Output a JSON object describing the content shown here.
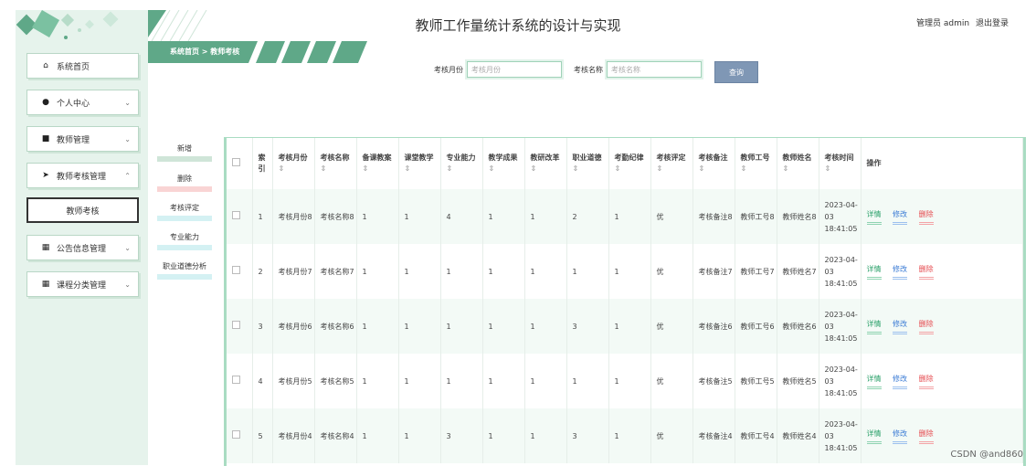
{
  "header": {
    "title": "教师工作量统计系统的设计与实现",
    "user": "管理员 admin",
    "logout": "退出登录"
  },
  "breadcrumb": {
    "home": "系统首页",
    "sep": ">",
    "current": "教师考核"
  },
  "sidebar": {
    "items": [
      {
        "icon": "home-icon",
        "label": "系统首页"
      },
      {
        "icon": "user-icon",
        "label": "个人中心"
      },
      {
        "icon": "briefcase-icon",
        "label": "教师管理"
      },
      {
        "icon": "send-icon",
        "label": "教师考核管理"
      },
      {
        "icon": "grid-icon",
        "label": "公告信息管理"
      },
      {
        "icon": "grid-icon",
        "label": "课程分类管理"
      }
    ],
    "sub_item": "教师考核"
  },
  "search": {
    "month_label": "考核月份",
    "month_placeholder": "考核月份",
    "name_label": "考核名称",
    "name_placeholder": "考核名称",
    "button": "查询"
  },
  "actions": {
    "add": "新增",
    "delete": "删除",
    "eval": "考核评定",
    "ability": "专业能力",
    "ethics": "职业道德分析"
  },
  "table": {
    "headers": [
      "索引",
      "考核月份",
      "考核名称",
      "备课教案",
      "课堂教学",
      "专业能力",
      "教学成果",
      "教研改革",
      "职业道德",
      "考勤纪律",
      "考核评定",
      "考核备注",
      "教师工号",
      "教师姓名",
      "考核时间",
      "操作"
    ],
    "sort_symbol": "⇕",
    "rows": [
      {
        "idx": "1",
        "month": "考核月份8",
        "name": "考核名称8",
        "c1": "1",
        "c2": "1",
        "c3": "4",
        "c4": "1",
        "c5": "1",
        "c6": "2",
        "c7": "1",
        "eval": "优",
        "note": "考核备注8",
        "no": "教师工号8",
        "tname": "教师姓名8",
        "time": "2023-04-03 18:41:05"
      },
      {
        "idx": "2",
        "month": "考核月份7",
        "name": "考核名称7",
        "c1": "1",
        "c2": "1",
        "c3": "1",
        "c4": "1",
        "c5": "1",
        "c6": "1",
        "c7": "1",
        "eval": "优",
        "note": "考核备注7",
        "no": "教师工号7",
        "tname": "教师姓名7",
        "time": "2023-04-03 18:41:05"
      },
      {
        "idx": "3",
        "month": "考核月份6",
        "name": "考核名称6",
        "c1": "1",
        "c2": "1",
        "c3": "1",
        "c4": "1",
        "c5": "1",
        "c6": "3",
        "c7": "1",
        "eval": "优",
        "note": "考核备注6",
        "no": "教师工号6",
        "tname": "教师姓名6",
        "time": "2023-04-03 18:41:05"
      },
      {
        "idx": "4",
        "month": "考核月份5",
        "name": "考核名称5",
        "c1": "1",
        "c2": "1",
        "c3": "1",
        "c4": "1",
        "c5": "1",
        "c6": "1",
        "c7": "1",
        "eval": "优",
        "note": "考核备注5",
        "no": "教师工号5",
        "tname": "教师姓名5",
        "time": "2023-04-03 18:41:05"
      },
      {
        "idx": "5",
        "month": "考核月份4",
        "name": "考核名称4",
        "c1": "1",
        "c2": "1",
        "c3": "3",
        "c4": "1",
        "c5": "1",
        "c6": "3",
        "c7": "1",
        "eval": "优",
        "note": "考核备注4",
        "no": "教师工号4",
        "tname": "教师姓名4",
        "time": "2023-04-03 18:41:05"
      }
    ],
    "ops": {
      "detail": "详情",
      "edit": "修改",
      "delete": "删除"
    }
  },
  "watermark": "CSDN @and860",
  "colors": {
    "accent": "#2aa069",
    "sidebar_bg": "#e6f3ec",
    "search_btn": "#7f97b5"
  }
}
